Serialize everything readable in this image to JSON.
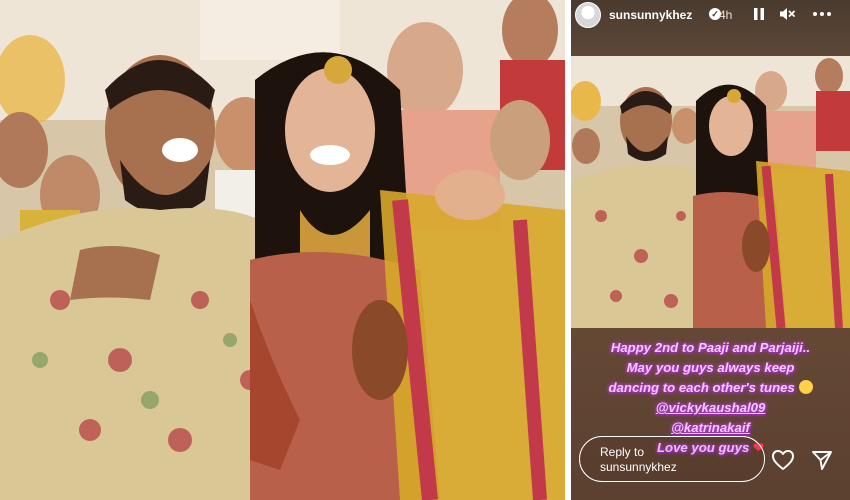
{
  "story": {
    "username": "sunsunnykhez",
    "time": "4h",
    "caption": {
      "line1": "Happy 2nd to Paaji and Parjaiji..",
      "line2": "May you guys always keep",
      "line3": "dancing to each other's tunes",
      "mention1": "@vickykaushal09",
      "mention2": "@katrinakaif",
      "line6": "Love you guys"
    },
    "reply": {
      "label": "Reply to",
      "target": "sunsunnykhez"
    }
  },
  "icons": {
    "verified": "verified-badge-icon",
    "pause": "pause-icon",
    "mute": "speaker-muted-icon",
    "more": "more-options-icon",
    "like": "heart-icon",
    "send": "send-icon"
  },
  "colors": {
    "caption_text": "#f6c7ff",
    "caption_glow": "#c64fe0",
    "ui_white": "#ffffff",
    "heart_red": "#ff3b5c"
  }
}
